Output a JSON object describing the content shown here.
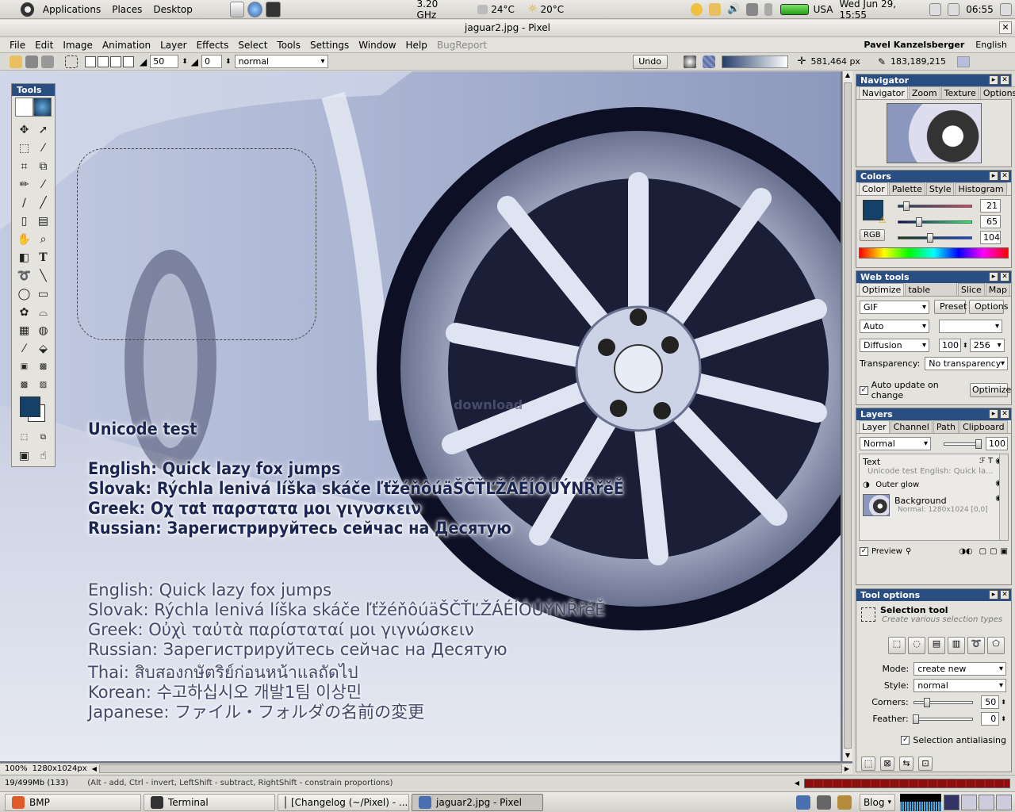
{
  "top_panel": {
    "menus": [
      "Applications",
      "Places",
      "Desktop"
    ],
    "cpu": "3.20 GHz",
    "temp1": "24°C",
    "temp2": "20°C",
    "locale": "USA",
    "datetime": "Wed Jun 29, 15:55",
    "time": "06:55"
  },
  "window": {
    "title": "jaguar2.jpg - Pixel"
  },
  "menubar": {
    "items": [
      "File",
      "Edit",
      "Image",
      "Animation",
      "Layer",
      "Effects",
      "Select",
      "Tools",
      "Settings",
      "Window",
      "Help",
      "BugReport"
    ],
    "user": "Pavel Kanzelsberger",
    "language": "English"
  },
  "optbar": {
    "size1": "50",
    "size2": "0",
    "mode": "normal",
    "undo": "Undo",
    "coord1": "581,464 px",
    "coord2": "183,189,215"
  },
  "canvas": {
    "bold_heading": "Unicode test",
    "bold_lines": [
      "English: Quick lazy fox jumps",
      "Slovak: Rýchla lenivá líška skáče ľťžéňôúäŠČŤĽŽÁÉÍÓÚÝNŘřěĚ",
      "Greek: Οχ ταt παρστατα μοι γιγνσκειν",
      "Russian: Зарегистрируйтесь сейчас на Десятую"
    ],
    "plain_lines": [
      "English: Quick lazy fox jumps",
      "Slovak: Rýchla lenivá líška skáče ľťžéňôúäŠČŤĽŽÁÉÍÓÚÝNŘřěĚ",
      "Greek: Οὐχὶ ταὐτὰ παρίσταταί μοι γιγνώσκειν",
      "Russian: Зарегистрируйтесь сейчас на Десятую",
      "Thai: สิบสองกษัตริย์ก่อนหน้าแลถัดไป",
      "Korean: 수고하십시오 개발1팀 이상민",
      "Japanese: ファイル・フォルダの名前の変更"
    ],
    "watermark": "download"
  },
  "tools_panel": {
    "title": "Tools"
  },
  "navigator": {
    "title": "Navigator",
    "tabs": [
      "Navigator",
      "Zoom",
      "Texture",
      "Options"
    ]
  },
  "colors": {
    "title": "Colors",
    "tabs": [
      "Color",
      "Palette",
      "Style",
      "Histogram"
    ],
    "r": "21",
    "g": "65",
    "b": "104",
    "model": "RGB",
    "fg_color": "#154168"
  },
  "webtools": {
    "title": "Web tools",
    "tabs": [
      "Optimize",
      "Color table",
      "Slice",
      "Map"
    ],
    "format": "GIF",
    "preset": "Preset",
    "options": "Options",
    "palette": "Auto",
    "dither": "Diffusion",
    "dither_amount": "100",
    "colors": "256",
    "transparency_label": "Transparency:",
    "transparency": "No transparency",
    "auto_update": "Auto update on change",
    "optimize": "Optimize"
  },
  "layers": {
    "title": "Layers",
    "tabs": [
      "Layer",
      "Channel",
      "Path",
      "Clipboard"
    ],
    "blend": "Normal",
    "opacity": "100",
    "items": [
      {
        "name": "Text",
        "sub": "Unicode test English: Quick la..."
      },
      {
        "name": "Outer glow",
        "sub": ""
      },
      {
        "name": "Background",
        "sub": "Normal: 1280x1024 [0,0]"
      }
    ],
    "preview": "Preview"
  },
  "tool_options": {
    "title": "Tool options",
    "tool_name": "Selection tool",
    "tool_desc": "Create various selection types",
    "mode_label": "Mode:",
    "mode": "create new",
    "style_label": "Style:",
    "style": "normal",
    "corners_label": "Corners:",
    "corners": "50",
    "feather_label": "Feather:",
    "feather": "0",
    "antialias": "Selection antialiasing"
  },
  "hscroll": {
    "zoom": "100%",
    "size": "1280x1024px"
  },
  "status": {
    "memory": "19/499Mb (133)",
    "hint": "(Alt - add, Ctrl - invert, LeftShift - subtract, RightShift - constrain proportions)"
  },
  "taskbar": {
    "tasks": [
      "BMP",
      "Terminal",
      "[Changelog (~/Pixel) - ...",
      "jaguar2.jpg - Pixel"
    ],
    "blog": "Blog"
  }
}
